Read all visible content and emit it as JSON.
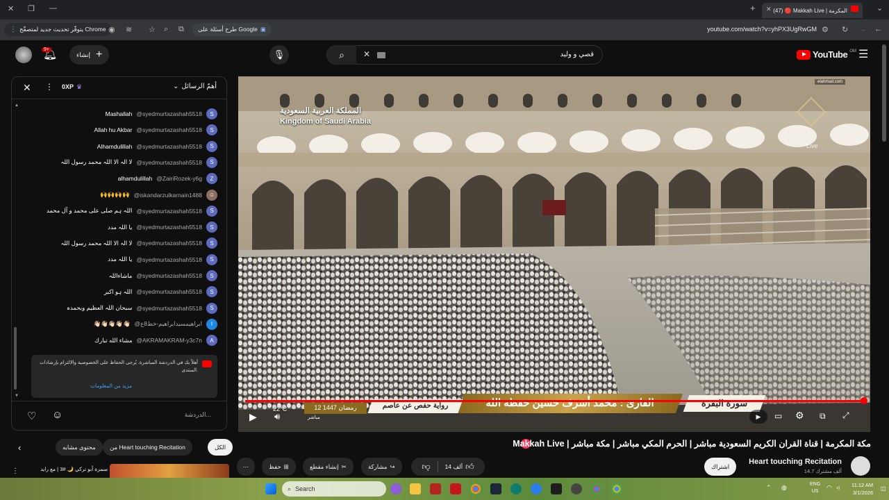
{
  "browser": {
    "tab_title": "(47) 🔴 Makkah Live | المكرمة",
    "url": "youtube.com/watch?v=yhPX3UgRwGM",
    "update_chip": "يتوفّر تحديث جديد لمتصفّح Chrome",
    "google_chip": "طرح أسئلة على Google"
  },
  "header": {
    "search_value": "قصي و وليد",
    "logo_text": "YouTube",
    "logo_region": "OM",
    "create_label": "إنشاء",
    "notif_count": "9+"
  },
  "chat": {
    "title": "أهمّ الرسائل",
    "xp": "0XP",
    "messages": [
      {
        "author": "@syedmurtazashah5518",
        "text": "Mashallah",
        "avatar": "S",
        "color": "#5c6bc0"
      },
      {
        "author": "@syedmurtazashah5518",
        "text": "Allah hu Akbar",
        "avatar": "S",
        "color": "#5c6bc0"
      },
      {
        "author": "@syedmurtazashah5518",
        "text": "Alhamdulillah",
        "avatar": "S",
        "color": "#5c6bc0"
      },
      {
        "author": "@syedmurtazashah5518",
        "text": "لا الہ الا اللہ محمد رسول اللہ",
        "avatar": "S",
        "color": "#5c6bc0"
      },
      {
        "author": "@ZairiRozek-y6g",
        "text": "alhamdulillah",
        "avatar": "Z",
        "color": "#5c6bc0"
      },
      {
        "author": "@iskandarzulkarnain1488",
        "text": "🙌🙌🙌🙌",
        "avatar": "☺",
        "color": "#8d6e63"
      },
      {
        "author": "@syedmurtazashah5518",
        "text": "اللہ ہم صلی علی محمد و آل محمد",
        "avatar": "S",
        "color": "#5c6bc0"
      },
      {
        "author": "@syedmurtazashah5518",
        "text": "یا اللہ مدد",
        "avatar": "S",
        "color": "#5c6bc0"
      },
      {
        "author": "@syedmurtazashah5518",
        "text": "لا الہ الا اللہ محمد رسول اللہ",
        "avatar": "S",
        "color": "#5c6bc0"
      },
      {
        "author": "@syedmurtazashah5518",
        "text": "یا اللہ مدد",
        "avatar": "S",
        "color": "#5c6bc0"
      },
      {
        "author": "@syedmurtazashah5518",
        "text": "ماشاءاللہ",
        "avatar": "S",
        "color": "#5c6bc0"
      },
      {
        "author": "@syedmurtazashah5518",
        "text": "اللہ ہو اکبر",
        "avatar": "S",
        "color": "#5c6bc0"
      },
      {
        "author": "@syedmurtazashah5518",
        "text": "سبحان اللہ العظیم وبحمدہ",
        "avatar": "S",
        "color": "#5c6bc0"
      },
      {
        "author": "@ابراهيمسيدابراهيم-خط8ع",
        "text": "👋🏻👋🏻👋🏻👋🏻👋🏻",
        "avatar": "I",
        "color": "#1e88e5"
      },
      {
        "author": "@AKRAMAKRAM-y3c7n",
        "text": "مشاء الله تبارك",
        "avatar": "A",
        "color": "#5c6bc0"
      }
    ],
    "notice_text": "أهلاً بك في الدردشة المباشرة. يُرجى الحفاظ على الخصوصية والالتزام بإرشادات المنتدى.",
    "notice_link": "مزيد من المعلومات",
    "input_placeholder": "الدردشة..."
  },
  "video": {
    "kingdom_ar": "المملكة العربية السعودية",
    "kingdom_en": "Kingdom of Saudi Arabia",
    "watermark": "elahmad.com",
    "live_label": "Live",
    "surah": "سورة البقرة",
    "reciter": "القارئ : محمد أشرف حسين حفظه الله",
    "riwaya": "رواية حفص عن عاصم",
    "date_ar": "12 رمضان 1447",
    "temperature": "22°C",
    "live_ar": "مباشر"
  },
  "below": {
    "filters": [
      "الكل",
      "من Heart touching Recitation",
      "محتوى مشابه"
    ],
    "title_text": "Makkah Live | مكة المكرمة | قناة القران الكريم السعودية مباشر | الحرم المكي مباشر | مكة مباشر",
    "channel_name": "Heart touching Recitation",
    "subscribers": "14.7 ألف مشترك",
    "subscribe_label": "اشتراك",
    "likes": "14 ألف",
    "share_label": "مشاركة",
    "clip_label": "إنشاء مقطع",
    "save_label": "حفظ",
    "rec_title": "سمرة أبو تركي 🌙 #3 | مع رايد"
  },
  "taskbar": {
    "search_placeholder": "Search",
    "lang_top": "ENG",
    "lang_bottom": "US",
    "time": "11:12 AM",
    "date": "3/1/2026"
  }
}
